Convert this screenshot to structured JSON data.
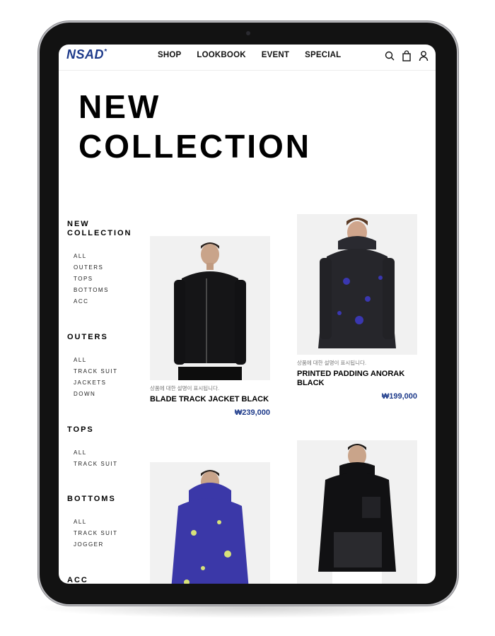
{
  "brand": {
    "logo": "NSAD",
    "logo_mark": "*",
    "color": "#1d3a8a"
  },
  "nav": {
    "items": [
      "SHOP",
      "LOOKBOOK",
      "EVENT",
      "SPECIAL"
    ]
  },
  "icons": [
    "search-icon",
    "shopping-bag-icon",
    "user-icon"
  ],
  "hero": {
    "line1": "NEW",
    "line2": "COLLECTION"
  },
  "sidebar": {
    "groups": [
      {
        "title": "NEW\nCOLLECTION",
        "items": [
          "ALL",
          "OUTERS",
          "TOPS",
          "BOTTOMS",
          "ACC"
        ]
      },
      {
        "title": "OUTERS",
        "items": [
          "ALL",
          "TRACK SUIT",
          "JACKETS",
          "DOWN"
        ]
      },
      {
        "title": "TOPS",
        "items": [
          "ALL",
          "TRACK SUIT"
        ]
      },
      {
        "title": "BOTTOMS",
        "items": [
          "ALL",
          "TRACK SUIT",
          "JOGGER"
        ]
      },
      {
        "title": "ACC",
        "items": []
      }
    ]
  },
  "products": [
    {
      "desc": "상품에 대한 설명이 표시됩니다.",
      "name": "BLADE TRACK JACKET BLACK",
      "price": "₩239,000",
      "jacket_color": "#151517"
    },
    {
      "desc": "상품에 대한 설명이 표시됩니다.",
      "name": "PRINTED PADDING ANORAK BLACK",
      "price": "₩199,000",
      "jacket_color": "#26262b"
    },
    {
      "desc": "",
      "name": "",
      "price": "",
      "jacket_color": "#3b38a8"
    },
    {
      "desc": "",
      "name": "",
      "price": "",
      "jacket_color": "#111113"
    }
  ]
}
